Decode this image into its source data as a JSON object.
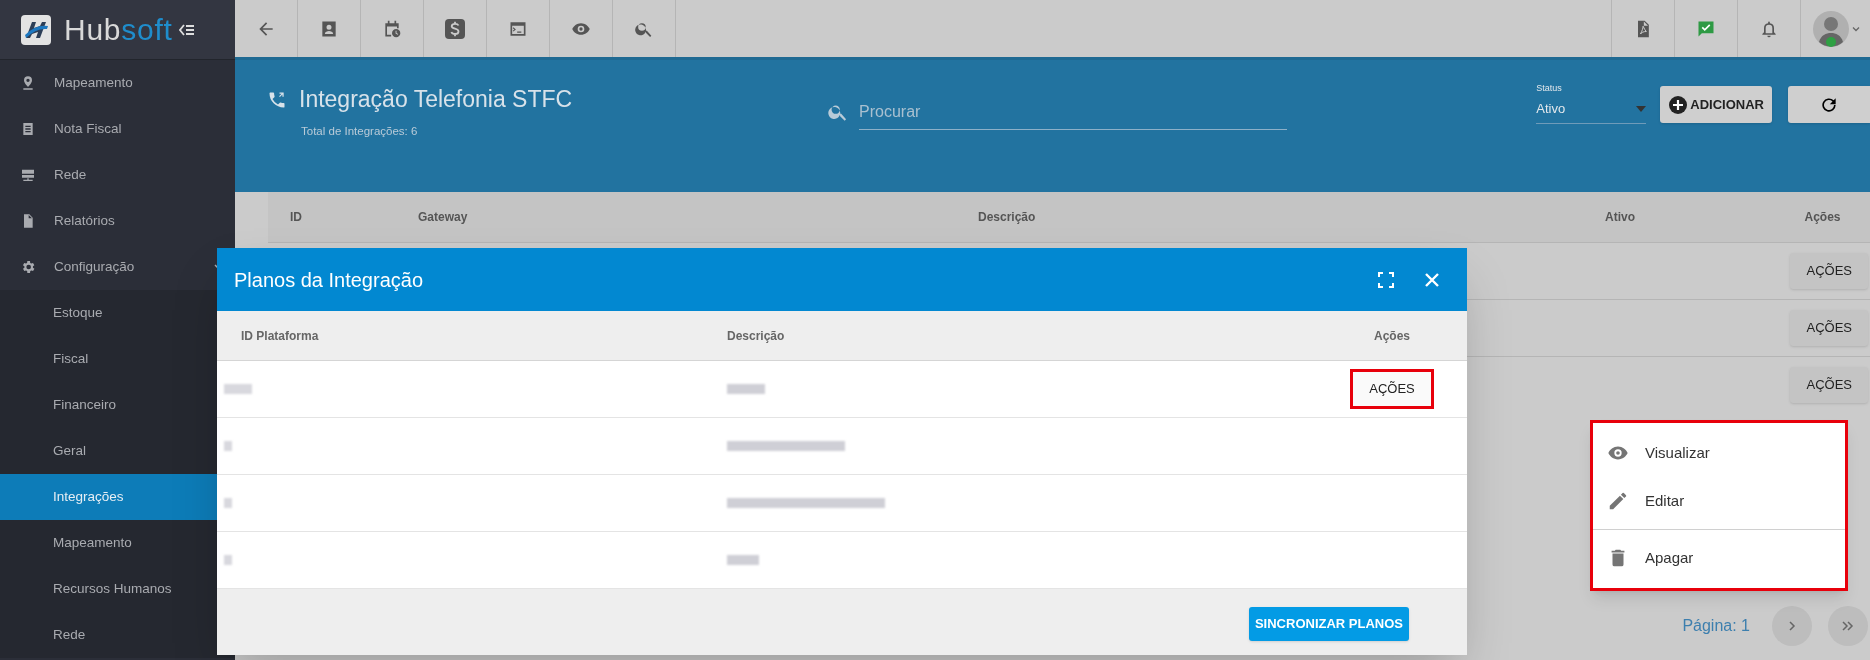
{
  "sidebar": {
    "brand": {
      "part_a": "Hub",
      "part_b": "soft"
    },
    "items": [
      {
        "label": "Mapeamento",
        "selected": false
      },
      {
        "label": "Nota Fiscal",
        "selected": false
      },
      {
        "label": "Rede",
        "selected": false
      },
      {
        "label": "Relatórios",
        "selected": false
      },
      {
        "label": "Configuração",
        "selected": false,
        "expanded": true,
        "children": [
          {
            "label": "Estoque",
            "selected": false
          },
          {
            "label": "Fiscal",
            "selected": false
          },
          {
            "label": "Financeiro",
            "selected": false
          },
          {
            "label": "Geral",
            "selected": false
          },
          {
            "label": "Integrações",
            "selected": true
          },
          {
            "label": "Mapeamento",
            "selected": false
          },
          {
            "label": "Recursos Humanos",
            "selected": false
          },
          {
            "label": "Rede",
            "selected": false
          }
        ]
      }
    ]
  },
  "header": {
    "title": "Integração Telefonia STFC",
    "subtitle": "Total de Integrações: 6",
    "search": {
      "placeholder": "Procurar"
    },
    "status": {
      "label": "Status",
      "value": "Ativo"
    },
    "add_button": "ADICIONAR"
  },
  "table": {
    "columns": [
      "ID",
      "Gateway",
      "Descrição",
      "Ativo",
      "Ações"
    ],
    "rows": [
      {
        "action": "AÇÕES"
      },
      {
        "action": "AÇÕES"
      },
      {
        "action": "AÇÕES"
      }
    ],
    "pager": "Página: 1"
  },
  "modal": {
    "title": "Planos da Integração",
    "columns": [
      "ID Plataforma",
      "Descrição",
      "Ações"
    ],
    "rows": [
      {
        "redacted": true,
        "action": "AÇÕES",
        "action_highlighted": true
      },
      {
        "redacted": true
      },
      {
        "redacted": true
      },
      {
        "redacted": true
      }
    ],
    "footer_button": "SINCRONIZAR PLANOS"
  },
  "menu": {
    "highlighted": true,
    "items": [
      {
        "label": "Visualizar",
        "kind": "view",
        "separated": false
      },
      {
        "label": "Editar",
        "kind": "edit",
        "separated": false
      },
      {
        "label": "Apagar",
        "kind": "delete",
        "separated": true
      }
    ]
  }
}
